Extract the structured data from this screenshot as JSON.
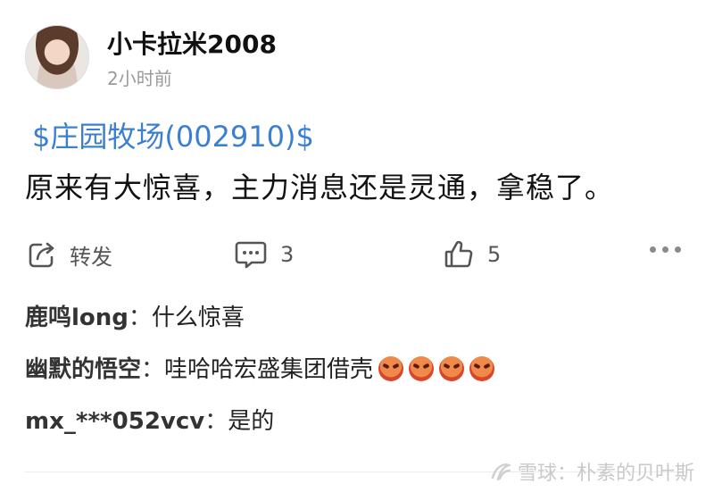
{
  "post": {
    "username": "小卡拉米2008",
    "time": "2小时前",
    "stock_tag": "$庄园牧场(002910)$",
    "text": "原来有大惊喜，主力消息还是灵通，拿稳了。"
  },
  "actions": {
    "repost_label": "转发",
    "comment_count": "3",
    "like_count": "5"
  },
  "icons": {
    "repost": "repost-icon",
    "comment": "comment-icon",
    "like": "thumbs-up-icon",
    "more": "more-dots-icon",
    "emoji": "angry-face-emoji"
  },
  "comments": [
    {
      "author": "鹿鸣long",
      "colon": "：",
      "text": "什么惊喜"
    },
    {
      "author": "幽默的悟空",
      "colon": "：",
      "text": "哇哈哈宏盛集团借壳"
    },
    {
      "author": "mx_***052vcv",
      "colon": "：",
      "text": "是的"
    }
  ],
  "watermark": "雪球：朴素的贝叶斯",
  "colors": {
    "link": "#3b7fd1",
    "muted": "#9a9a9a"
  }
}
